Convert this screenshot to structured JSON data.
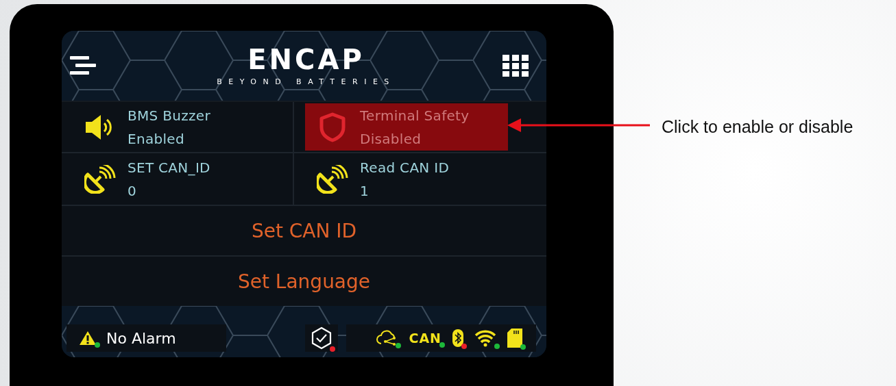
{
  "header": {
    "logo": "ENCAP",
    "tagline": "BEYOND BATTERIES"
  },
  "tiles": [
    {
      "kind": "speaker",
      "title": "BMS Buzzer",
      "value": "Enabled",
      "highlighted": false
    },
    {
      "kind": "shield",
      "title": "Terminal Safety",
      "value": "Disabled",
      "highlighted": true
    },
    {
      "kind": "dish",
      "title": "SET CAN_ID",
      "value": "0",
      "highlighted": false
    },
    {
      "kind": "dish",
      "title": "Read CAN ID",
      "value": "1",
      "highlighted": false
    }
  ],
  "buttons": [
    "Set CAN ID",
    "Set Language"
  ],
  "footer": {
    "alarm": {
      "text": "No Alarm",
      "color": "#1db83a"
    },
    "security": {
      "color": "#e8202a"
    },
    "indicators": [
      {
        "kind": "cloud",
        "color": "#1db83a"
      },
      {
        "kind": "can",
        "label": "CAN",
        "color": "#1db83a"
      },
      {
        "kind": "bluetooth",
        "color": "#e8202a"
      },
      {
        "kind": "wifi",
        "color": "#1db83a"
      },
      {
        "kind": "sdcard",
        "color": "#1db83a"
      }
    ]
  },
  "annotation": {
    "text": "Click to enable or disable"
  }
}
